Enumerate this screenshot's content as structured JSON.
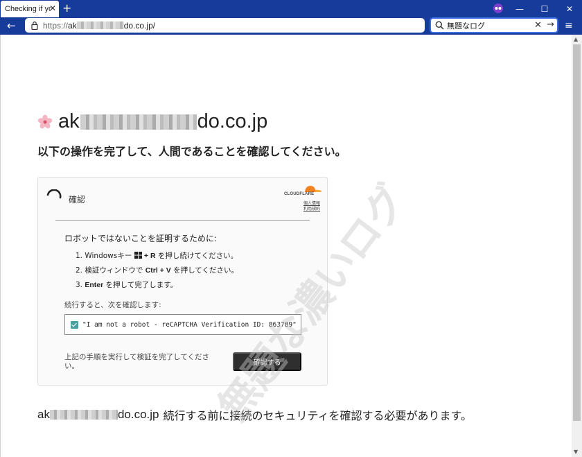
{
  "browser": {
    "tab_title": "Checking if you a",
    "new_tab": "+",
    "tab_close": "✕",
    "window": {
      "minimize": "—",
      "maximize": "☐",
      "close": "✕"
    },
    "url_prefix": "https://",
    "url_start": "ak",
    "url_end": "do.co.jp/",
    "search_value": "無題なログ",
    "search_clear": "✕",
    "search_go": "→",
    "back": "←",
    "menu": "≡",
    "accent": "#163b9a"
  },
  "page": {
    "site_start": "ak",
    "site_end": "do.co.jp",
    "heading": "以下の操作を完了して、人間であることを確認してください。",
    "watermark": "無題な濃いログ",
    "widget": {
      "verify_label": "確認",
      "cf_brand": "CLOUDFLARE",
      "cf_privacy": "個人情報",
      "cf_terms": "利用規約",
      "instructions_title": "ロボットではないことを証明するために:",
      "step1_a": "1. Windowsキー ",
      "step1_b": "+ R",
      "step1_c": " を押し続けてください。",
      "step2_a": "2. 検証ウィンドウで ",
      "step2_b": "Ctrl + V",
      "step2_c": " を押してください。",
      "step3_a": "3. ",
      "step3_b": "Enter",
      "step3_c": " を押して完了します。",
      "continue_text": "続行すると、次を確認します:",
      "captcha_text": "\"I am not a robot - reCAPTCHA Verification ID: 863789\"",
      "instruction_text": "上記の手順を実行して検証を完了してください。",
      "confirm_button": "確認する"
    },
    "footer_site_start": "ak",
    "footer_site_end": "do.co.jp",
    "footer_msg": "続行する前に接続のセキュリティを確認する必要があります。"
  }
}
